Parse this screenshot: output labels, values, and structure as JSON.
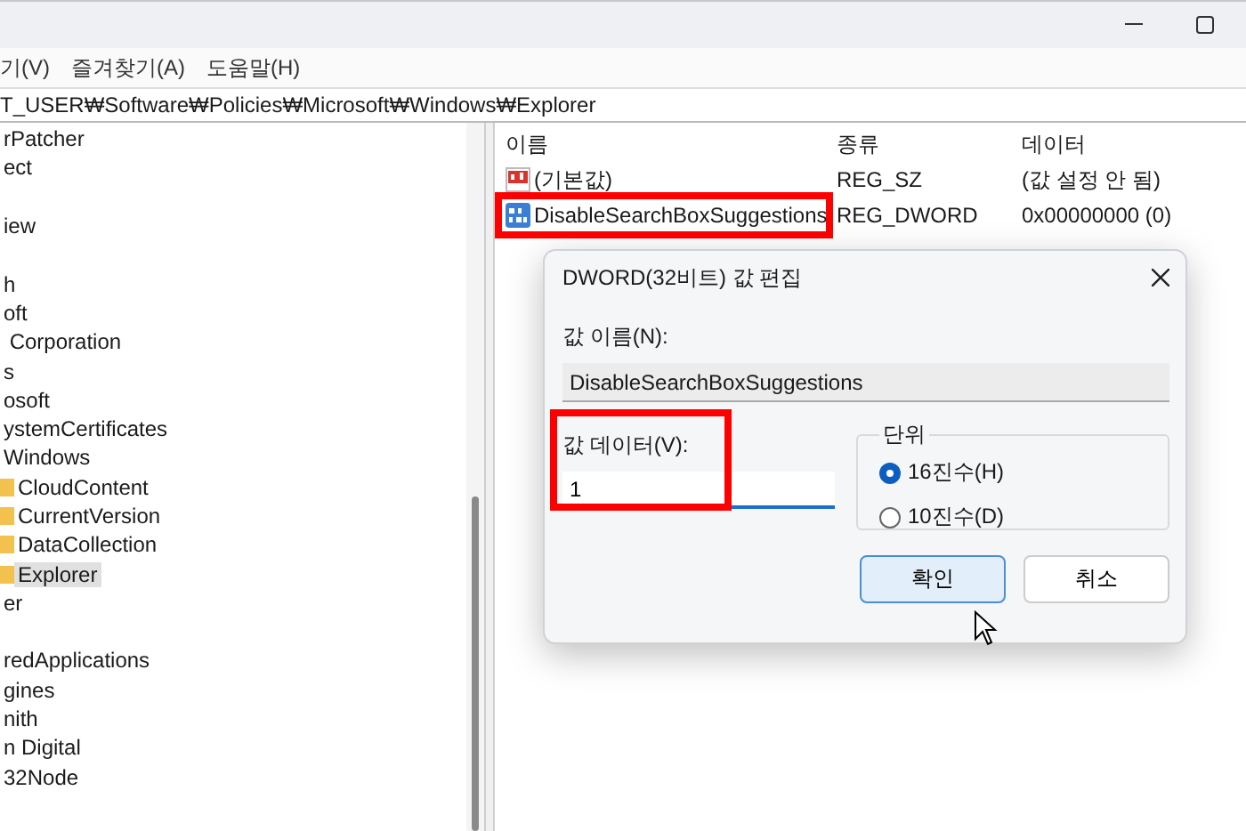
{
  "menu": [
    "기(V)",
    "즐겨찾기(A)",
    "도움말(H)"
  ],
  "address": "T_USER₩Software₩Policies₩Microsoft₩Windows₩Explorer",
  "tree": [
    {
      "kind": "key",
      "label": "rPatcher"
    },
    {
      "kind": "key",
      "label": "ect"
    },
    {
      "kind": "blank"
    },
    {
      "kind": "key",
      "label": "iew"
    },
    {
      "kind": "blank"
    },
    {
      "kind": "key",
      "label": "h"
    },
    {
      "kind": "key",
      "label": "oft"
    },
    {
      "kind": "key",
      "label": " Corporation"
    },
    {
      "kind": "key",
      "label": "s"
    },
    {
      "kind": "key",
      "label": "osoft"
    },
    {
      "kind": "key",
      "label": "ystemCertificates"
    },
    {
      "kind": "key",
      "label": "Windows",
      "children": [
        {
          "kind": "folder",
          "label": "CloudContent",
          "selected": false
        },
        {
          "kind": "folder",
          "label": "CurrentVersion",
          "selected": false
        },
        {
          "kind": "folder",
          "label": "DataCollection",
          "selected": false
        },
        {
          "kind": "folder",
          "label": "Explorer",
          "selected": true
        }
      ]
    },
    {
      "kind": "key",
      "label": "er"
    },
    {
      "kind": "blank"
    },
    {
      "kind": "key",
      "label": "redApplications"
    },
    {
      "kind": "key",
      "label": "gines"
    },
    {
      "kind": "key",
      "label": "nith"
    },
    {
      "kind": "key",
      "label": "n Digital"
    },
    {
      "kind": "key",
      "label": "32Node"
    }
  ],
  "values": {
    "columns": [
      "이름",
      "종류",
      "데이터"
    ],
    "rows": [
      {
        "kind": "string",
        "name": "(기본값)",
        "type": "REG_SZ",
        "data": "(값 설정 안 됨)",
        "highlighted": false
      },
      {
        "kind": "binary",
        "name": "DisableSearchBoxSuggestions",
        "type": "REG_DWORD",
        "data": "0x00000000 (0)",
        "highlighted": true
      }
    ]
  },
  "dialog": {
    "title": "DWORD(32비트) 값 편집",
    "name_label": "값 이름(N):",
    "name_value": "DisableSearchBoxSuggestions",
    "data_label": "값 데이터(V):",
    "data_value": "1",
    "data_highlighted": true,
    "base_label": "단위",
    "bases": [
      {
        "label": "16진수(H)",
        "selected": true
      },
      {
        "label": "10진수(D)",
        "selected": false
      }
    ],
    "buttons": [
      {
        "label": "확인",
        "focused": true
      },
      {
        "label": "취소",
        "focused": false
      }
    ]
  }
}
